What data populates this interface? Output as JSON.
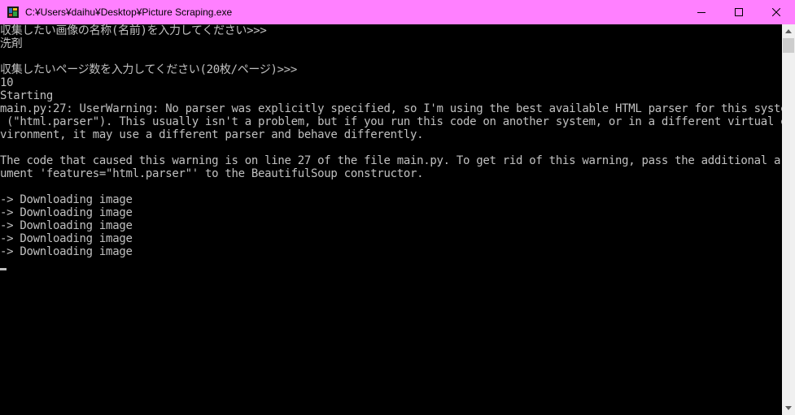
{
  "window": {
    "title": "C:¥Users¥daihu¥Desktop¥Picture Scraping.exe",
    "titlebar_color": "#ff80ff",
    "icons": [
      "app-icon",
      "minimize-icon",
      "maximize-icon",
      "close-icon"
    ]
  },
  "console": {
    "background": "#000000",
    "text_color": "#c0c0c0",
    "lines": [
      "収集したい画像の名称(名前)を入力してください>>>",
      "洗剤",
      "",
      "収集したいページ数を入力してください(20枚/ページ)>>>",
      "10",
      "Starting",
      "main.py:27: UserWarning: No parser was explicitly specified, so I'm using the best available HTML parser for this system",
      " (\"html.parser\"). This usually isn't a problem, but if you run this code on another system, or in a different virtual en",
      "vironment, it may use a different parser and behave differently.",
      "",
      "The code that caused this warning is on line 27 of the file main.py. To get rid of this warning, pass the additional arg",
      "ument 'features=\"html.parser\"' to the BeautifulSoup constructor.",
      "",
      "-> Downloading image",
      "-> Downloading image",
      "-> Downloading image",
      "-> Downloading image",
      "-> Downloading image"
    ]
  }
}
